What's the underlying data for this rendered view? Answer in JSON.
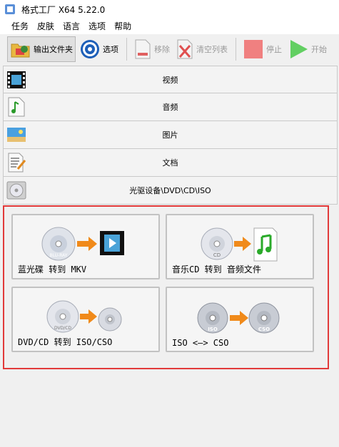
{
  "window": {
    "title": "格式工厂 X64 5.22.0"
  },
  "menu": [
    "任务",
    "皮肤",
    "语言",
    "选项",
    "帮助"
  ],
  "toolbar": {
    "output_folder": "输出文件夹",
    "options": "选项",
    "remove": "移除",
    "clear_list": "清空列表",
    "stop": "停止",
    "start": "开始"
  },
  "categories": [
    {
      "label": "视频",
      "icon": "film-icon"
    },
    {
      "label": "音频",
      "icon": "music-note-icon"
    },
    {
      "label": "图片",
      "icon": "picture-icon"
    },
    {
      "label": "文档",
      "icon": "document-icon"
    },
    {
      "label": "光驱设备\\DVD\\CD\\ISO",
      "icon": "disc-drive-icon"
    }
  ],
  "disc_tools": [
    {
      "label": "蓝光碟 转到 MKV",
      "icon": "bluray-to-video-icon"
    },
    {
      "label": "音乐CD 转到 音频文件",
      "icon": "cd-to-audio-icon"
    },
    {
      "label": "DVD/CD 转到 ISO/CSO",
      "icon": "dvd-to-iso-icon"
    },
    {
      "label": "ISO <—> CSO",
      "icon": "iso-cso-icon"
    }
  ],
  "icon_text": {
    "bluray": "BLU-RAY",
    "cd": "CD",
    "dvd": "DVD/CD",
    "iso": "ISO",
    "cso": "CSO"
  },
  "colors": {
    "highlight_border": "#e23a3a",
    "start_green": "#4cc24c",
    "stop_red": "#f08080"
  }
}
